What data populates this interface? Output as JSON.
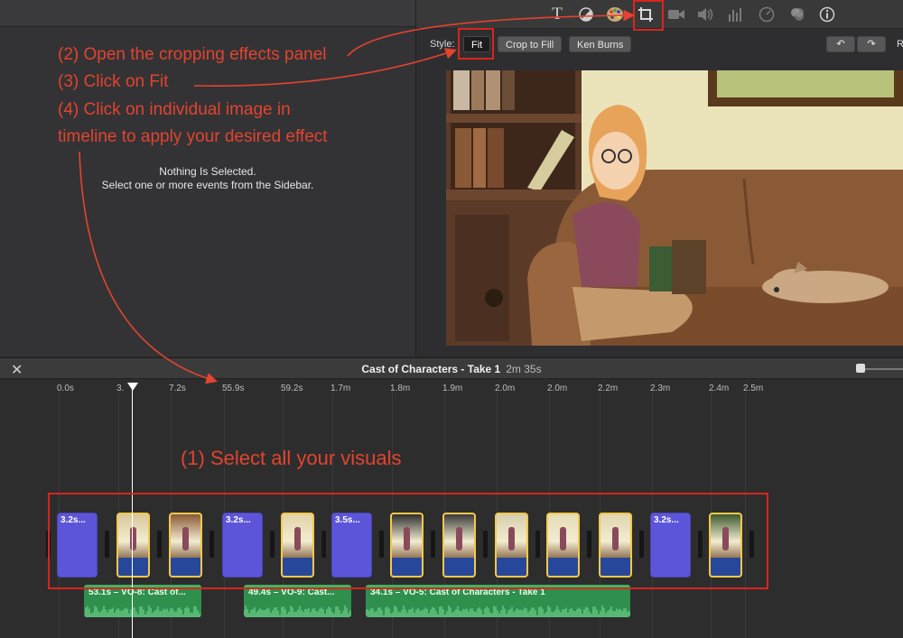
{
  "browser": {
    "empty_title": "Nothing Is Selected.",
    "empty_sub": "Select one or more events from the Sidebar."
  },
  "toolbar": {
    "icons": [
      "title-icon",
      "color-balance-icon",
      "color-palette-icon",
      "crop-icon",
      "camera-stabilization-icon",
      "volume-icon",
      "equalizer-icon",
      "speed-icon",
      "clip-filter-icon",
      "info-icon"
    ],
    "active_icon": "crop-icon"
  },
  "style_bar": {
    "label": "Style:",
    "fit": "Fit",
    "crop_to_fill": "Crop to Fill",
    "ken_burns": "Ken Burns",
    "active": "Fit",
    "rotate_left": "↶",
    "rotate_right": "↷",
    "r": "R"
  },
  "timeline": {
    "close": "✕",
    "project_name": "Cast of Characters - Take 1",
    "project_duration": "2m 35s",
    "ruler": [
      "0.0s",
      "3.",
      "7.2s",
      "55.9s",
      "59.2s",
      "1.7m",
      "1.8m",
      "1.9m",
      "2.0m",
      "2.0m",
      "2.2m",
      "2.3m",
      "2.4m",
      "2.5m"
    ],
    "clips": [
      {
        "type": "color",
        "label": "3.2s..."
      },
      {
        "type": "image",
        "label": ""
      },
      {
        "type": "image",
        "label": ""
      },
      {
        "type": "color",
        "label": "3.2s..."
      },
      {
        "type": "image",
        "label": ""
      },
      {
        "type": "color",
        "label": "3.5s..."
      },
      {
        "type": "image",
        "label": ""
      },
      {
        "type": "image",
        "label": ""
      },
      {
        "type": "image",
        "label": ""
      },
      {
        "type": "image",
        "label": ""
      },
      {
        "type": "image",
        "label": ""
      },
      {
        "type": "color",
        "label": "3.2s..."
      },
      {
        "type": "image",
        "label": ""
      }
    ],
    "audio": [
      {
        "label": "53.1s – VO-8: Cast of..."
      },
      {
        "label": "49.4s – VO-9: Cast..."
      },
      {
        "label": "34.1s – VO-5: Cast of Characters - Take 1"
      }
    ]
  },
  "annotations": {
    "step2": "(2) Open the cropping effects panel",
    "step3": "(3) Click on Fit",
    "step4a": "(4) Click on individual image in",
    "step4b": "timeline to apply your desired effect",
    "step1": "(1) Select all your visuals",
    "color": "#e3432f"
  },
  "colors": {
    "accent_clip_border": "#f5c84a",
    "color_clip": "#5d55d9",
    "audio": "#2f8f4d"
  }
}
